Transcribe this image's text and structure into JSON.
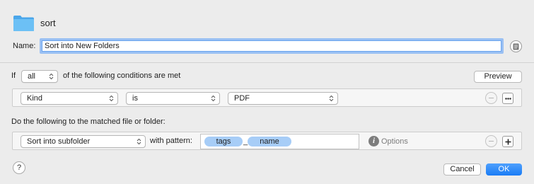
{
  "header": {
    "folder_name": "sort"
  },
  "name_field": {
    "label": "Name:",
    "value": "Sort into New Folders"
  },
  "conditions": {
    "if_label": "If",
    "match_mode": "all",
    "suffix": "of the following conditions are met",
    "preview_label": "Preview",
    "rows": [
      {
        "attribute": "Kind",
        "operator": "is",
        "value": "PDF"
      }
    ]
  },
  "actions": {
    "label": "Do the following to the matched file or folder:",
    "rows": [
      {
        "action": "Sort into subfolder",
        "pattern_label": "with pattern:",
        "tokens": [
          "tags",
          "name"
        ],
        "separator": "_",
        "options_label": "Options"
      }
    ]
  },
  "buttons": {
    "help": "?",
    "cancel": "Cancel",
    "ok": "OK"
  },
  "colors": {
    "accent": "#1a7cf5",
    "token": "#a7cdf7",
    "folder": "#5fb3ef"
  }
}
